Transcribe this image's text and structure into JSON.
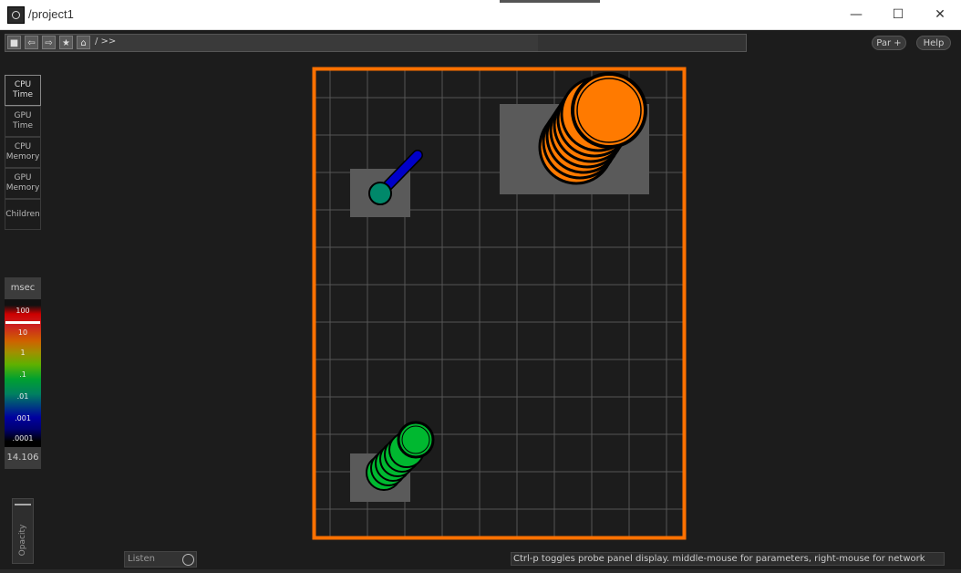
{
  "window": {
    "title": "/project1",
    "minimize_glyph": "—",
    "maximize_glyph": "☐",
    "close_glyph": "✕"
  },
  "toolbar": {
    "stop_glyph": "■",
    "back_glyph": "⇦",
    "forward_glyph": "⇨",
    "favorite_glyph": "★",
    "home_glyph": "⌂",
    "path": "/ >>",
    "par_label": "Par +",
    "help_label": "Help"
  },
  "side_tabs": [
    {
      "label": "CPU\nTime",
      "active": true
    },
    {
      "label": "GPU\nTime",
      "active": false
    },
    {
      "label": "CPU\nMemory",
      "active": false
    },
    {
      "label": "GPU\nMemory",
      "active": false
    },
    {
      "label": "Children",
      "active": false
    }
  ],
  "legend": {
    "unit": "msec",
    "ticks": [
      "100",
      "10",
      "1",
      ".1",
      ".01",
      ".001",
      ".0001"
    ],
    "value": "14.106"
  },
  "opacity": {
    "label": "Opacity"
  },
  "listen": {
    "label": "Listen"
  },
  "status": {
    "text": "Ctrl-p toggles probe panel display. middle-mouse for parameters, right-mouse for network"
  },
  "colors": {
    "frame": "#ff7100",
    "grid": "#555555",
    "node_box": "#5a5a5a",
    "orange": "#ff7a00",
    "green": "#00b830",
    "teal": "#00886a",
    "blue": "#0000c8"
  }
}
